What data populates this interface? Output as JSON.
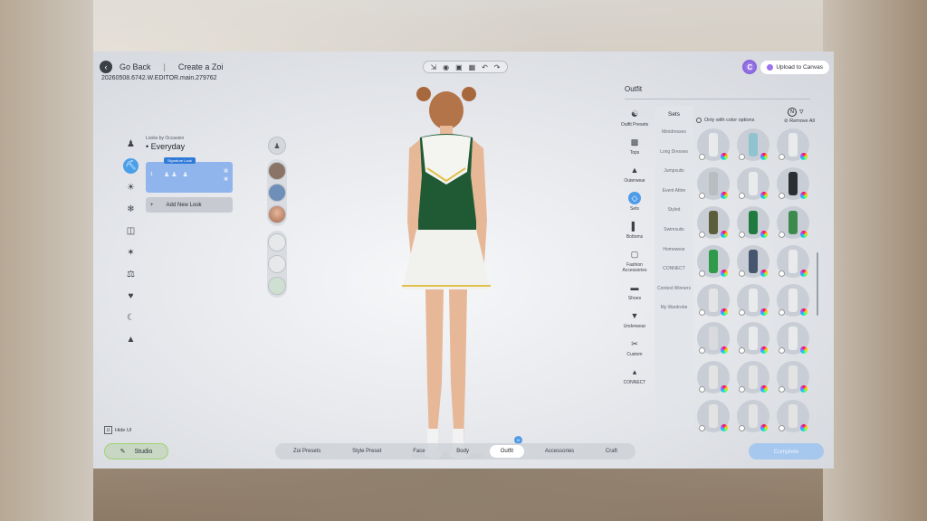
{
  "header": {
    "back_label": "Go Back",
    "separator": "|",
    "title": "Create a Zoi",
    "build": "20260508.6742.W.EDITOR.main.279762"
  },
  "toolbar": {
    "icons": [
      "import-icon",
      "camera-icon",
      "focus-icon",
      "capture-icon",
      "undo-icon",
      "redo-icon"
    ]
  },
  "canvas": {
    "avatar_letter": "C",
    "upload_label": "Upload to Canvas"
  },
  "looks": {
    "occasion_label": "Looks by Occasion",
    "occasion_value": "Everyday",
    "badge": "Signature Look",
    "look_number": "1",
    "add_label": "Add New Look",
    "add_symbol": "+"
  },
  "outfit": {
    "title": "Outfit",
    "filter_label": "Only with color options",
    "remove_all": "Remove All",
    "new_badge": "N",
    "categories": [
      {
        "label": "Outfit Presets",
        "icon": "hanger-icon"
      },
      {
        "label": "Tops",
        "icon": "shirt-icon"
      },
      {
        "label": "Outerwear",
        "icon": "jacket-icon"
      },
      {
        "label": "Sets",
        "icon": "dress-icon"
      },
      {
        "label": "Bottoms",
        "icon": "pants-icon"
      },
      {
        "label": "Fashion Accessories",
        "icon": "bag-icon"
      },
      {
        "label": "Shoes",
        "icon": "shoe-icon"
      },
      {
        "label": "Underwear",
        "icon": "underwear-icon"
      },
      {
        "label": "Custom",
        "icon": "scissors-icon"
      },
      {
        "label": "CONNECT",
        "icon": "connect-icon"
      }
    ],
    "sets_header": "Sets",
    "sets": [
      "Minidresses",
      "Long Dresses",
      "Jumpsuits",
      "Event Attire",
      "Styled",
      "Swimsuits",
      "Homewear",
      "CONNECT",
      "Contest Winners",
      "My Wardrobe"
    ]
  },
  "bottom": {
    "hide_ui_key": "U",
    "hide_ui_label": "Hide UI",
    "studio_label": "Studio",
    "tabs": [
      "Zoi Presets",
      "Style Preset",
      "Face",
      "Body",
      "Outfit",
      "Accessories",
      "Craft"
    ],
    "active_tab_badge": "N",
    "complete_label": "Complete"
  }
}
